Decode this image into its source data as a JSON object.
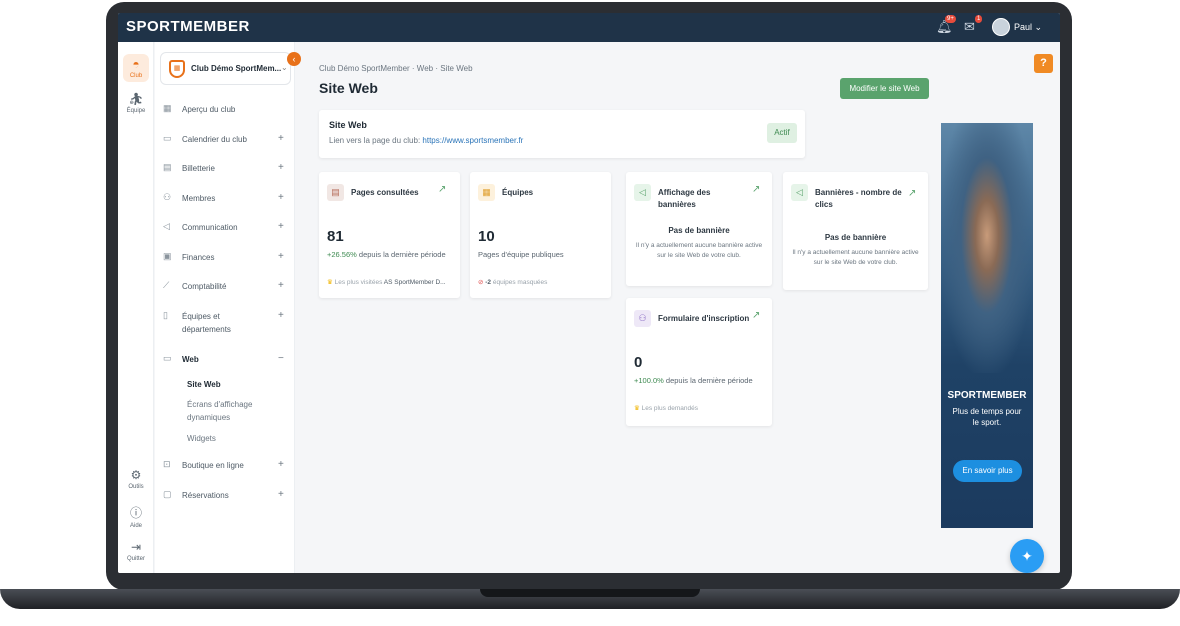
{
  "topbar": {
    "logo": "SPORTMEMBER",
    "notifications_badge": "9+",
    "messages_badge": "1",
    "user_name": "Paul",
    "user_chevron": "⌄"
  },
  "rail": {
    "club": "Club",
    "team": "Équipe",
    "tools": "Outils",
    "help": "Aide",
    "quit": "Quitter"
  },
  "sidebar": {
    "club_name": "Club Démo SportMem...",
    "club_chevron": "⌄",
    "collapse": "‹",
    "items": [
      {
        "label": "Aperçu du club",
        "icon": "grid-icon",
        "action": ""
      },
      {
        "label": "Calendrier du club",
        "icon": "calendar-icon",
        "action": "+"
      },
      {
        "label": "Billetterie",
        "icon": "ticket-icon",
        "action": "+"
      },
      {
        "label": "Membres",
        "icon": "members-icon",
        "action": "+"
      },
      {
        "label": "Communication",
        "icon": "megaphone-icon",
        "action": "+"
      },
      {
        "label": "Finances",
        "icon": "finance-icon",
        "action": "+"
      },
      {
        "label": "Comptabilité",
        "icon": "chart-icon",
        "action": "+"
      },
      {
        "label": "Équipes et départements",
        "icon": "team-icon",
        "action": "+"
      },
      {
        "label": "Web",
        "icon": "monitor-icon",
        "action": "−"
      },
      {
        "label": "Boutique en ligne",
        "icon": "shop-icon",
        "action": "+"
      },
      {
        "label": "Réservations",
        "icon": "booking-icon",
        "action": "+"
      }
    ],
    "web_sub": [
      "Site Web",
      "Écrans d'affichage dynamiques",
      "Widgets"
    ]
  },
  "main": {
    "breadcrumb": "Club Démo SportMember  ·  Web  ·  Site Web",
    "title": "Site Web",
    "modify_button": "Modifier le site Web",
    "help": "?",
    "site_card": {
      "title": "Site Web",
      "link_prefix": "Lien vers la page du club: ",
      "link": "https://www.sportsmember.fr",
      "status": "Actif"
    },
    "cards": {
      "pages": {
        "title": "Pages consultées",
        "value": "81",
        "change": "+26.56%",
        "change_suffix": " depuis la dernière période",
        "foot_prefix": "Les plus visitées ",
        "foot_value": "AS SportMember D..."
      },
      "teams": {
        "title": "Équipes",
        "value": "10",
        "sub": "Pages d'équipe publiques",
        "foot_value": "-2",
        "foot_suffix": " équipes masquées"
      },
      "banners": {
        "title": "Affichage des bannières",
        "empty_title": "Pas de bannière",
        "empty_text": "Il n'y a actuellement aucune bannière active sur le site Web de votre club."
      },
      "banner_clicks": {
        "title": "Bannières - nombre de clics",
        "empty_title": "Pas de bannière",
        "empty_text": "Il n'y a actuellement aucune bannière active sur le site Web de votre club."
      },
      "form": {
        "title": "Formulaire d'inscription",
        "value": "0",
        "change": "+100.0%",
        "change_suffix": " depuis la dernière période",
        "foot": "Les plus demandés"
      }
    },
    "ad": {
      "brand": "SPORTMEMBER",
      "slogan": "Plus de temps pour le sport.",
      "cta": "En savoir plus"
    }
  },
  "colors": {
    "topbar": "#1f3348",
    "accent": "#e8711a",
    "primary_button": "#5aa36d",
    "link": "#2a74b8",
    "fab": "#2a9df4"
  }
}
